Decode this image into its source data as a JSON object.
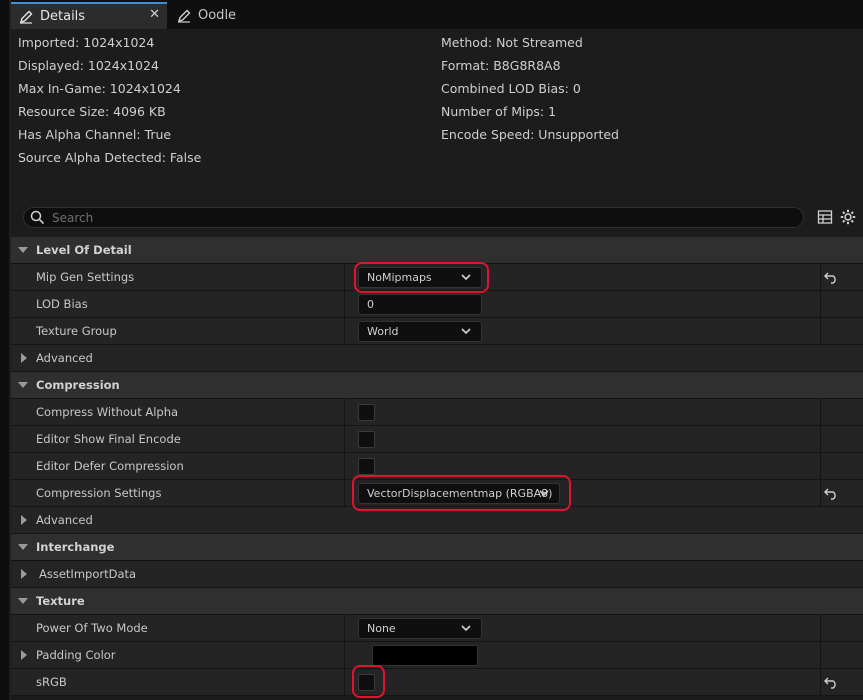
{
  "tabs": [
    {
      "label": "Details",
      "icon": "pencil-icon"
    },
    {
      "label": "Oodle",
      "icon": "pencil-icon"
    }
  ],
  "info": {
    "imported": "Imported: 1024x1024",
    "displayed": "Displayed: 1024x1024",
    "max_in_game": "Max In-Game: 1024x1024",
    "resource_size": "Resource Size: 4096 KB",
    "has_alpha": "Has Alpha Channel: True",
    "source_alpha": "Source Alpha Detected: False",
    "method": "Method: Not Streamed",
    "format": "Format: B8G8R8A8",
    "lod_bias": "Combined LOD Bias: 0",
    "mips": "Number of Mips: 1",
    "encode_speed": "Encode Speed: Unsupported"
  },
  "search": {
    "placeholder": "Search"
  },
  "sections": {
    "lod": {
      "title": "Level Of Detail",
      "mip_gen_label": "Mip Gen Settings",
      "mip_gen_value": "NoMipmaps",
      "lod_bias_label": "LOD Bias",
      "lod_bias_value": "0",
      "texture_group_label": "Texture Group",
      "texture_group_value": "World",
      "advanced_label": "Advanced"
    },
    "compression": {
      "title": "Compression",
      "without_alpha_label": "Compress Without Alpha",
      "without_alpha_checked": false,
      "show_final_label": "Editor Show Final Encode",
      "show_final_checked": false,
      "defer_label": "Editor Defer Compression",
      "defer_checked": false,
      "settings_label": "Compression Settings",
      "settings_value": "VectorDisplacementmap (RGBA8)",
      "advanced_label": "Advanced"
    },
    "interchange": {
      "title": "Interchange",
      "asset_import_label": "AssetImportData"
    },
    "texture": {
      "title": "Texture",
      "power_of_two_label": "Power Of Two Mode",
      "power_of_two_value": "None",
      "padding_color_label": "Padding Color",
      "padding_color_value": "#000000",
      "srgb_label": "sRGB",
      "srgb_checked": false
    }
  },
  "colors": {
    "accent": "#3a8fd8",
    "highlight": "#e0142f",
    "background": "#1a1a1a"
  }
}
